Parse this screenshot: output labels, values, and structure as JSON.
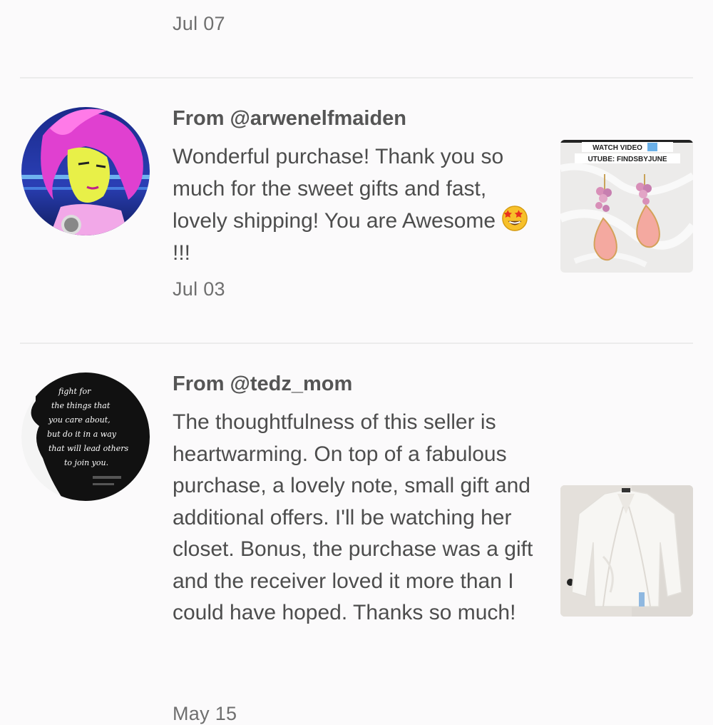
{
  "top_review": {
    "date": "Jul 07"
  },
  "reviews": [
    {
      "from": "From @arwenelfmaiden",
      "text_before_emoji": "Wonderful purchase! Thank you so much for the sweet gifts and fast, lovely shipping! You are Awesome ",
      "text_after_emoji": "!!!",
      "emoji_icon": "star-struck-emoji-icon",
      "date": "Jul 03",
      "avatar_icon": "pink-haired-anime-avatar",
      "thumbnail": {
        "icon": "pink-teardrop-earrings-photo",
        "overlay_line1": "WATCH VIDEO",
        "overlay_line2": "UTUBE: FINDSBYJUNE"
      }
    },
    {
      "from": "From @tedz_mom",
      "text": "The thoughtfulness of this seller is heartwarming. On top of a fabulous purchase, a lovely note, small gift and additional offers. I'll be watching her closet. Bonus, the purchase was a gift and the receiver loved it more than I could have hoped. Thanks so much!",
      "date": "May 15",
      "avatar_icon": "silhouette-quote-avatar",
      "avatar_quote": "fight for the things that you care about, but do it in a way that will lead others to join you.",
      "thumbnail": {
        "icon": "white-cardigan-photo"
      }
    }
  ],
  "colors": {
    "background": "#fbfafb",
    "text": "#4d4d4d",
    "date": "#6f6f6f",
    "divider": "#ececec"
  }
}
